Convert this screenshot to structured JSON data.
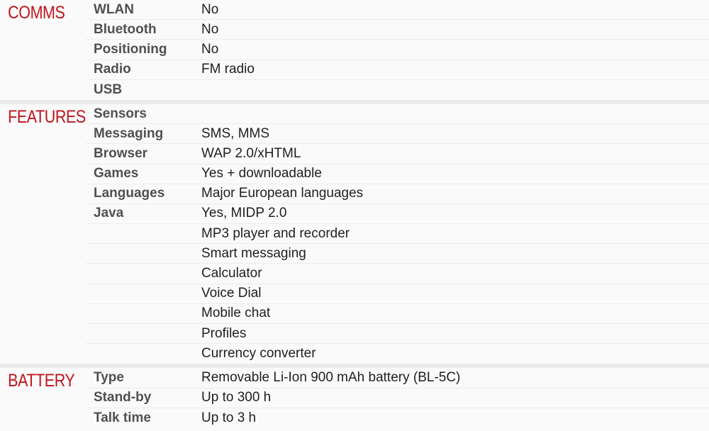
{
  "sections": [
    {
      "title": "COMMS",
      "rows": [
        {
          "label": "WLAN",
          "value": "No"
        },
        {
          "label": "Bluetooth",
          "value": "No"
        },
        {
          "label": "Positioning",
          "value": "No"
        },
        {
          "label": "Radio",
          "value": "FM radio"
        },
        {
          "label": "USB",
          "value": ""
        }
      ]
    },
    {
      "title": "FEATURES",
      "rows": [
        {
          "label": "Sensors",
          "value": ""
        },
        {
          "label": "Messaging",
          "value": "SMS, MMS"
        },
        {
          "label": "Browser",
          "value": "WAP 2.0/xHTML"
        },
        {
          "label": "Games",
          "value": "Yes + downloadable"
        },
        {
          "label": "Languages",
          "value": "Major European languages"
        },
        {
          "label": "Java",
          "value": "Yes, MIDP 2.0"
        },
        {
          "label": "",
          "value": "MP3 player and recorder"
        },
        {
          "label": "",
          "value": "Smart messaging"
        },
        {
          "label": "",
          "value": "Calculator"
        },
        {
          "label": "",
          "value": "Voice Dial"
        },
        {
          "label": "",
          "value": "Mobile chat"
        },
        {
          "label": "",
          "value": "Profiles"
        },
        {
          "label": "",
          "value": "Currency converter"
        }
      ]
    },
    {
      "title": "BATTERY",
      "rows": [
        {
          "label": "Type",
          "value": "Removable Li-Ion 900 mAh battery (BL-5C)"
        },
        {
          "label": "Stand-by",
          "value": "Up to 300 h"
        },
        {
          "label": "Talk time",
          "value": "Up to 3 h"
        }
      ]
    }
  ]
}
